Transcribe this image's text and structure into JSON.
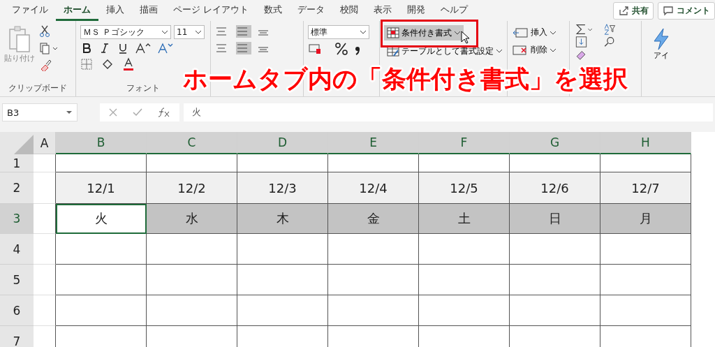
{
  "tabs": [
    {
      "label": "ファイル",
      "selected": false
    },
    {
      "label": "ホーム",
      "selected": true
    },
    {
      "label": "挿入",
      "selected": false
    },
    {
      "label": "描画",
      "selected": false
    },
    {
      "label": "ページ レイアウト",
      "selected": false
    },
    {
      "label": "数式",
      "selected": false
    },
    {
      "label": "データ",
      "selected": false
    },
    {
      "label": "校閲",
      "selected": false
    },
    {
      "label": "表示",
      "selected": false
    },
    {
      "label": "開発",
      "selected": false
    },
    {
      "label": "ヘルプ",
      "selected": false
    }
  ],
  "top_buttons": [
    {
      "label": "共有",
      "kind": "share"
    },
    {
      "label": "コメント",
      "kind": "comment"
    }
  ],
  "ribbon": {
    "paste": "貼り付け",
    "clipboard_label": "クリップボード",
    "font_name": "ＭＳ Ｐゴシック",
    "font_size": "11",
    "font_label": "フォント",
    "number_format": "標準",
    "conditional_format": "条件付き書式",
    "table_format": "テーブルとして書式設定",
    "insert": "挿入",
    "delete": "削除",
    "ideas": "アイ"
  },
  "annotation": "ホームタブ内の「条件付き書式」を選択",
  "formula_bar": {
    "name_box": "B3",
    "value": "火"
  },
  "columns": [
    {
      "label": "A",
      "selected": false
    },
    {
      "label": "B",
      "selected": true
    },
    {
      "label": "C",
      "selected": true
    },
    {
      "label": "D",
      "selected": true
    },
    {
      "label": "E",
      "selected": true
    },
    {
      "label": "F",
      "selected": true
    },
    {
      "label": "G",
      "selected": true
    },
    {
      "label": "H",
      "selected": true
    }
  ],
  "rows": [
    {
      "label": "1",
      "selected": false,
      "cells": []
    },
    {
      "label": "2",
      "selected": false,
      "cells": [
        {
          "text": "12/1"
        },
        {
          "text": "12/2"
        },
        {
          "text": "12/3"
        },
        {
          "text": "12/4"
        },
        {
          "text": "12/5"
        },
        {
          "text": "12/6"
        },
        {
          "text": "12/7"
        }
      ]
    },
    {
      "label": "3",
      "selected": true,
      "cells": [
        {
          "text": "火",
          "active": true
        },
        {
          "text": "水",
          "active": false
        },
        {
          "text": "木",
          "active": false
        },
        {
          "text": "金",
          "active": false
        },
        {
          "text": "土",
          "active": false
        },
        {
          "text": "日",
          "active": false
        },
        {
          "text": "月",
          "active": false
        }
      ]
    },
    {
      "label": "4",
      "selected": false,
      "cells": []
    },
    {
      "label": "5",
      "selected": false,
      "cells": []
    },
    {
      "label": "6",
      "selected": false,
      "cells": []
    },
    {
      "label": "7",
      "selected": false,
      "cells": []
    }
  ]
}
